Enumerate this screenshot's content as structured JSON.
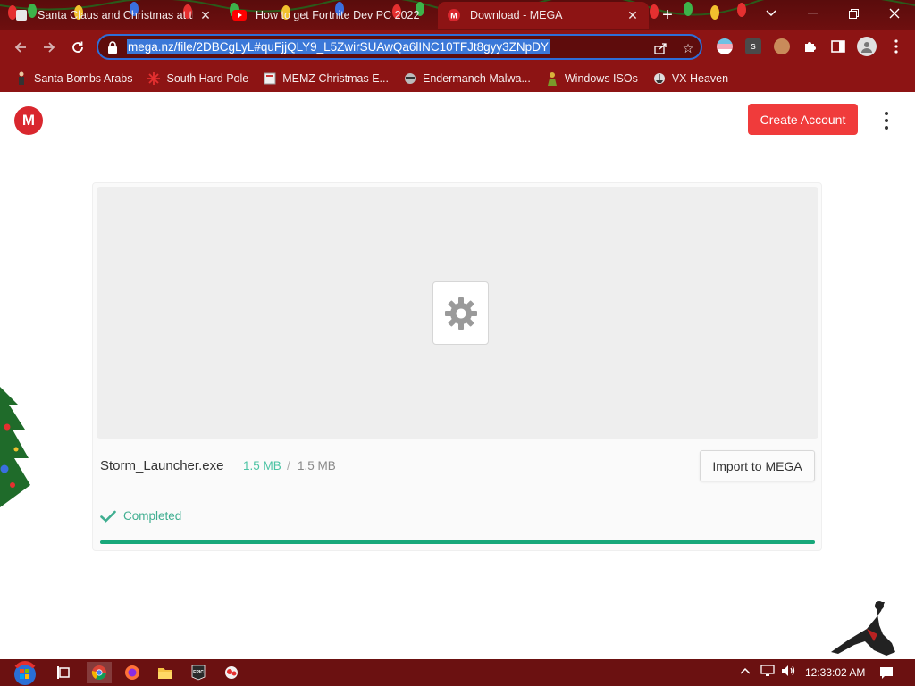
{
  "browser": {
    "tabs": [
      {
        "title": "Santa Claus and Christmas at the",
        "favicon": "page-icon",
        "active": false
      },
      {
        "title": "How to get Fortnite Dev PC 2022",
        "favicon": "youtube-icon",
        "active": false
      },
      {
        "title": "Download - MEGA",
        "favicon": "mega-icon",
        "active": true
      }
    ],
    "new_tab_label": "+",
    "url": "mega.nz/file/2DBCgLyL#quFjjQLY9_L5ZwirSUAwQa6lINC10TFJt8gyy3ZNpDY",
    "bookmarks": [
      {
        "label": "Santa Bombs Arabs",
        "icon": "figure-icon"
      },
      {
        "label": "South Hard Pole",
        "icon": "snowflake-icon"
      },
      {
        "label": "MEMZ Christmas E...",
        "icon": "page-icon"
      },
      {
        "label": "Endermanch Malwa...",
        "icon": "raccoon-icon"
      },
      {
        "label": "Windows ISOs",
        "icon": "person-icon"
      },
      {
        "label": "VX Heaven",
        "icon": "ship-icon"
      }
    ]
  },
  "page": {
    "logo_letter": "M",
    "create_account_label": "Create Account",
    "file": {
      "name": "Storm_Launcher.exe",
      "downloaded": "1.5 MB",
      "separator": "/",
      "total": "1.5 MB",
      "import_label": "Import to MEGA",
      "status": "Completed",
      "progress": 1.0
    }
  },
  "taskbar": {
    "clock": "12:33:02 AM",
    "pinned": [
      "task-view-icon",
      "chrome-icon",
      "firefox-icon",
      "file-explorer-icon",
      "epic-games-icon",
      "app-icon"
    ]
  },
  "colors": {
    "chrome_bg": "#8d1414",
    "accent_red": "#f03b3b",
    "success_green": "#17a87a"
  }
}
